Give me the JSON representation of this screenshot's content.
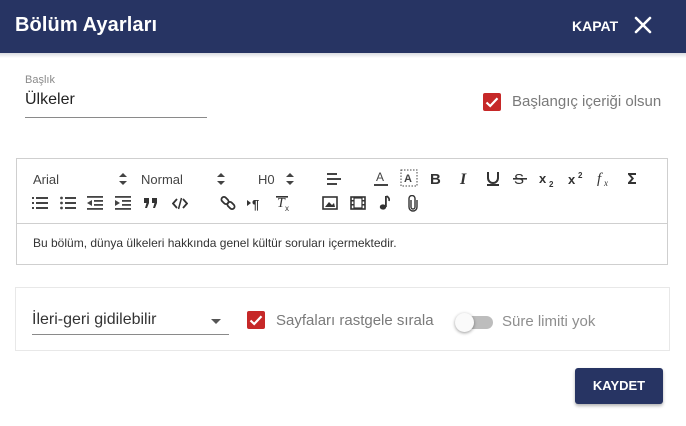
{
  "header": {
    "title": "Bölüm Ayarları",
    "close_label": "KAPAT",
    "background": "#273463"
  },
  "form": {
    "title_field": {
      "label": "Başlık",
      "value": "Ülkeler"
    },
    "start_content_checkbox": {
      "label": "Başlangıç içeriği olsun",
      "checked": true
    }
  },
  "editor": {
    "font": "Arial",
    "style": "Normal",
    "heading": "H0",
    "content": "Bu bölüm, dünya ülkeleri hakkında genel kültür soruları içermektedir."
  },
  "settings": {
    "navigation_select": "İleri-geri gidilebilir",
    "shuffle_pages": {
      "label": "Sayfaları rastgele sırala",
      "checked": true
    },
    "time_limit": {
      "label": "Süre limiti yok",
      "on": false
    }
  },
  "actions": {
    "save_label": "KAYDET"
  },
  "colors": {
    "accent": "#c62828",
    "primary": "#273463"
  }
}
